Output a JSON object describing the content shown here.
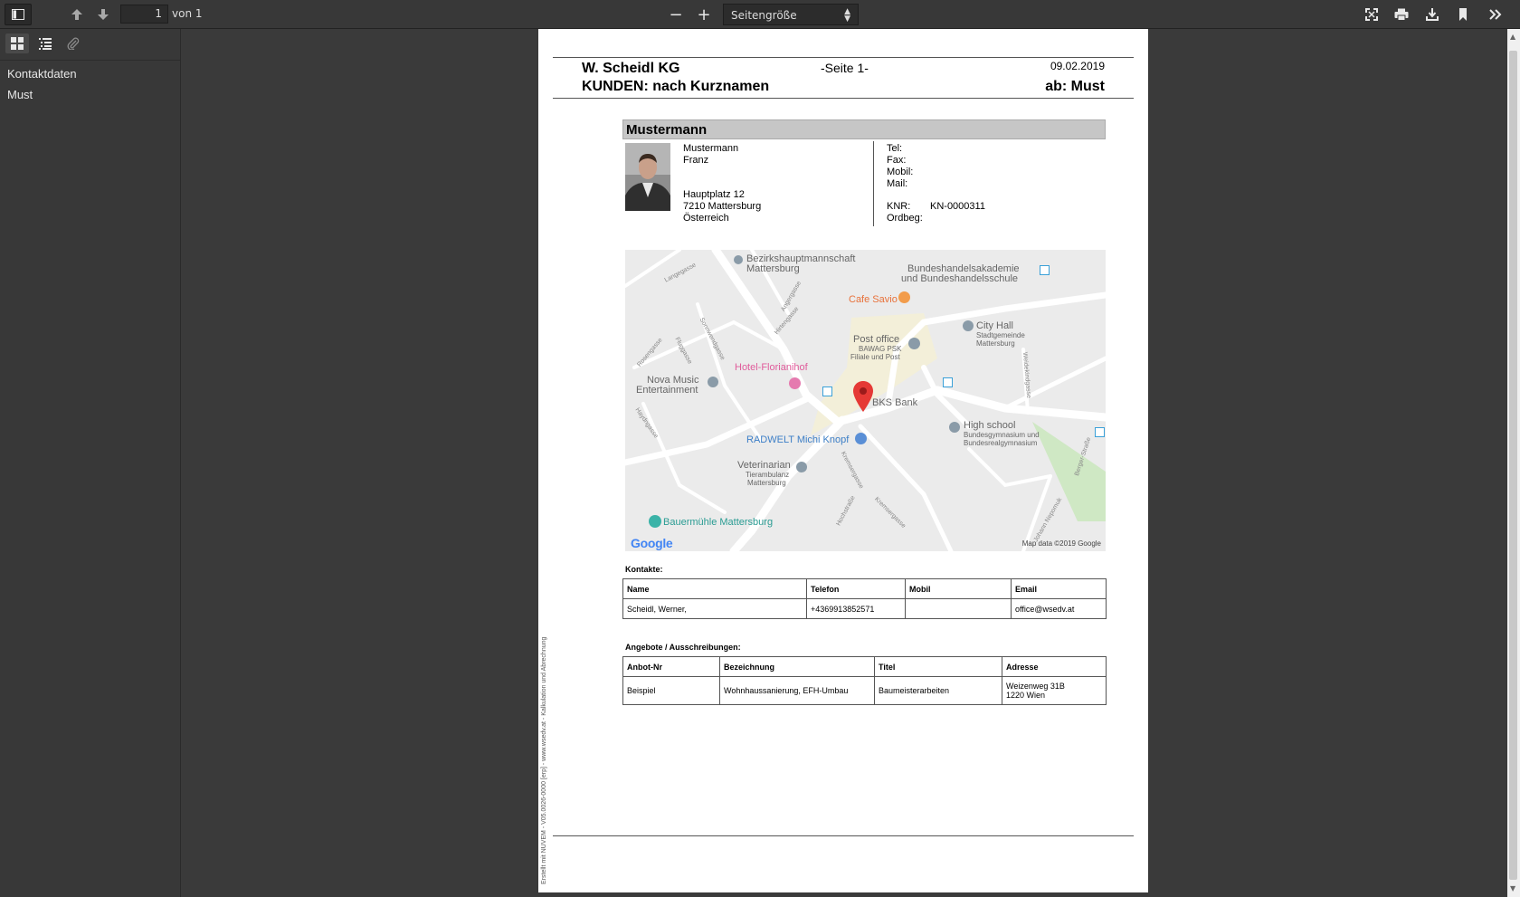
{
  "toolbar": {
    "page_number": "1",
    "page_count": "von 1",
    "zoom_minus": "−",
    "zoom_plus": "+",
    "scale": "Seitengröße"
  },
  "sidebar": {
    "outline": [
      {
        "label": "Kontaktdaten"
      },
      {
        "label": "Must"
      }
    ]
  },
  "document": {
    "company": "W. Scheidl KG",
    "report_title": "KUNDEN: nach Kurznamen",
    "page_label": "-Seite 1-",
    "date": "09.02.2019",
    "filter": "ab: Must",
    "customer": {
      "heading": "Mustermann",
      "last_name": "Mustermann",
      "first_name": "Franz",
      "street": "Hauptplatz 12",
      "city": "7210 Mattersburg",
      "country": "Österreich",
      "labels": {
        "tel": "Tel:",
        "fax": "Fax:",
        "mobil": "Mobil:",
        "mail": "Mail:",
        "knr": "KNR:",
        "ordbeg": "Ordbeg:"
      },
      "knr": "KN-0000311"
    },
    "map": {
      "places": {
        "bh": "Bezirkshauptmannschaft",
        "bh2": "Mattersburg",
        "bhak": "Bundeshandelsakademie",
        "bhak2": "und Bundeshandelsschule",
        "cafe": "Cafe Savio",
        "city_hall": "City Hall",
        "city_hall2": "Stadtgemeinde",
        "city_hall3": "Mattersburg",
        "post": "Post office",
        "post2": "BAWAG PSK",
        "post3": "Filiale und Post",
        "hotel": "Hotel-Florianihof",
        "nova": "Nova Music",
        "nova2": "Entertainment",
        "bks": "BKS Bank",
        "school": "High school",
        "school2": "Bundesgymnasium und",
        "school3": "Bundesrealgymnasium",
        "radwelt": "RADWELT Michi Knopf",
        "vet": "Veterinarian",
        "vet2": "Tierambulanz",
        "vet3": "Mattersburg",
        "muehle": "Bauermühle Mattersburg"
      },
      "streets": {
        "s1": "Langegasse",
        "s2": "Angergasse",
        "s3": "Hirtengasse",
        "s4": "Sonnwendgasse",
        "s5": "Rosengasse",
        "s6": "Fluggasse",
        "s7": "Haydngasse",
        "s8": "Weidekindgasse",
        "s9": "Kremsergasse",
        "s10": "Hochstraße",
        "s11": "Kremsergasse",
        "s12": "Berger-Straße",
        "s13": "Johann Nepomuk"
      },
      "google": "Google",
      "attribution": "Map data ©2019 Google"
    },
    "contacts": {
      "title": "Kontakte:",
      "headers": [
        "Name",
        "Telefon",
        "Mobil",
        "Email"
      ],
      "rows": [
        [
          "Scheidl, Werner,",
          "+4369913852571",
          "",
          "office@wsedv.at"
        ]
      ]
    },
    "offers": {
      "title": "Angebote / Ausschreibungen:",
      "headers": [
        "Anbot-Nr",
        "Bezeichnung",
        "Titel",
        "Adresse"
      ],
      "rows": [
        [
          "Beispiel",
          "Wohnhaussanierung, EFH-Umbau",
          "Baumeisterarbeiten",
          "Weizenweg 31B",
          "1220 Wien"
        ]
      ]
    },
    "footer_side": "Erstellt mit NUVEM - V05.0026-0000 [erp] - www.wsedv.at - Kalkulation und Abrechnung"
  }
}
